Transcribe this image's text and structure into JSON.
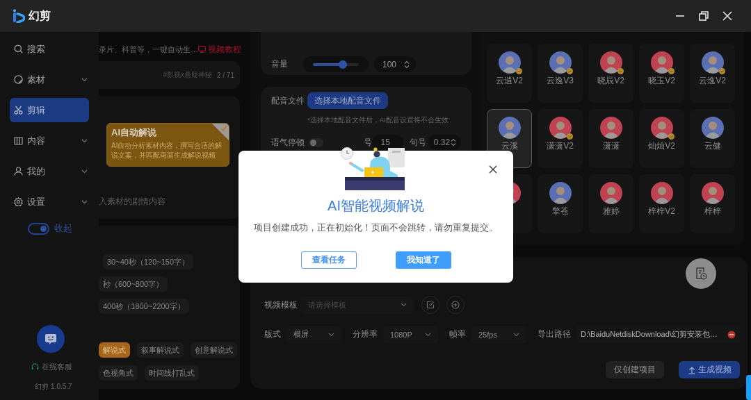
{
  "title_bar": {
    "app_name": "幻剪"
  },
  "sidebar": {
    "items": [
      {
        "label": "搜索",
        "has_submenu": false,
        "selected": false
      },
      {
        "label": "素材",
        "has_submenu": true,
        "selected": false
      },
      {
        "label": "剪辑",
        "has_submenu": false,
        "selected": true
      },
      {
        "label": "内容",
        "has_submenu": true,
        "selected": false
      },
      {
        "label": "我的",
        "has_submenu": true,
        "selected": false
      },
      {
        "label": "设置",
        "has_submenu": true,
        "selected": false
      }
    ],
    "collapse_toggle": {
      "label": "收起",
      "on": true
    },
    "support_link": "在线客服",
    "version": "幻剪 1.0.5.7"
  },
  "content": {
    "intro": "录片、科普等，一键自动生…",
    "tutorial_link": "视频教程",
    "material": {
      "tags": "#影视x悬疑神秘",
      "counter": "2 / 71"
    },
    "mode_cards": [
      {
        "title": "AI自动解说",
        "description": "AI自动分析素材内容，撰写合适的解说文案，并匹配画面生成解说视频",
        "selected": true
      }
    ],
    "plot_hint": "入素材的剧情内容",
    "durations": [
      {
        "label": "30~40秒（120~150字）",
        "selected": false
      },
      {
        "label": "秒（600~800字）",
        "selected": false
      },
      {
        "label": "400秒（1800~2200字）",
        "selected": false
      }
    ],
    "styles": [
      {
        "label": "解说式",
        "selected": true
      },
      {
        "label": "叙事解说式",
        "selected": false
      },
      {
        "label": "创意解说式",
        "selected": false
      },
      {
        "label": "色视角式",
        "selected": false
      },
      {
        "label": "时间线打乱式",
        "selected": false
      }
    ]
  },
  "voice_settings": {
    "volume": {
      "label": "音量",
      "level": 0.65,
      "value": "100"
    }
  },
  "dubbing": {
    "label": "配音文件",
    "button": "选择本地配音文件",
    "hint": "*选择本地配音文件后，AI配音设置将不会生效",
    "pause": {
      "label": "语气停顿",
      "on": false
    },
    "comma": {
      "label": "号",
      "value": "15"
    },
    "period": {
      "label": "句号",
      "value": "0.32"
    }
  },
  "voices": [
    {
      "name": "云逍V2",
      "color": "#5b6fb5",
      "premium": true,
      "selected": false
    },
    {
      "name": "云逸V3",
      "color": "#5b6fb5",
      "premium": true,
      "selected": false
    },
    {
      "name": "晓辰V2",
      "color": "#bf4350",
      "premium": true,
      "selected": false
    },
    {
      "name": "晓玉V2",
      "color": "#bf4350",
      "premium": true,
      "selected": false
    },
    {
      "name": "云逸V2",
      "color": "#5b6fb5",
      "premium": true,
      "selected": false
    },
    {
      "name": "云溪",
      "color": "#5b6fb5",
      "premium": false,
      "selected": true
    },
    {
      "name": "潇潇V2",
      "color": "#bf4350",
      "premium": true,
      "selected": false
    },
    {
      "name": "潇潇",
      "color": "#bf4350",
      "premium": false,
      "selected": false
    },
    {
      "name": "灿灿V2",
      "color": "#bf4350",
      "premium": true,
      "selected": false
    },
    {
      "name": "云健",
      "color": "#5b6fb5",
      "premium": false,
      "selected": false
    },
    {
      "color": "#bf4350",
      "premium": false,
      "selected": false
    },
    {
      "name": "擎苍",
      "color": "#5b6fb5",
      "premium": false,
      "selected": false
    },
    {
      "name": "雅婷",
      "color": "#bf4350",
      "premium": false,
      "selected": false
    },
    {
      "name": "梓梓V2",
      "color": "#bf4350",
      "premium": false,
      "selected": false
    },
    {
      "name": "梓梓",
      "color": "#bf4350",
      "premium": false,
      "selected": false
    }
  ],
  "export": {
    "template": {
      "label": "视频模板",
      "placeholder": "请选择模板"
    },
    "settings": [
      {
        "label": "版式",
        "value": "横屏"
      },
      {
        "label": "分辨率",
        "value": "1080P"
      },
      {
        "label": "帧率",
        "value": "25fps"
      }
    ],
    "path": {
      "label": "导出路径",
      "value": "D:\\BaiduNetdiskDownload\\幻剪安装包…"
    },
    "buttons": [
      {
        "label": "仅创建项目",
        "kind": "secondary"
      },
      {
        "label": "生成视频",
        "kind": "primary"
      }
    ]
  },
  "dialog": {
    "title": "AI智能视频解说",
    "message": "项目创建成功，正在初始化！页面不会跳转，请勿重复提交。",
    "buttons": [
      {
        "label": "查看任务",
        "kind": "outline"
      },
      {
        "label": "我知道了",
        "kind": "primary"
      }
    ]
  }
}
